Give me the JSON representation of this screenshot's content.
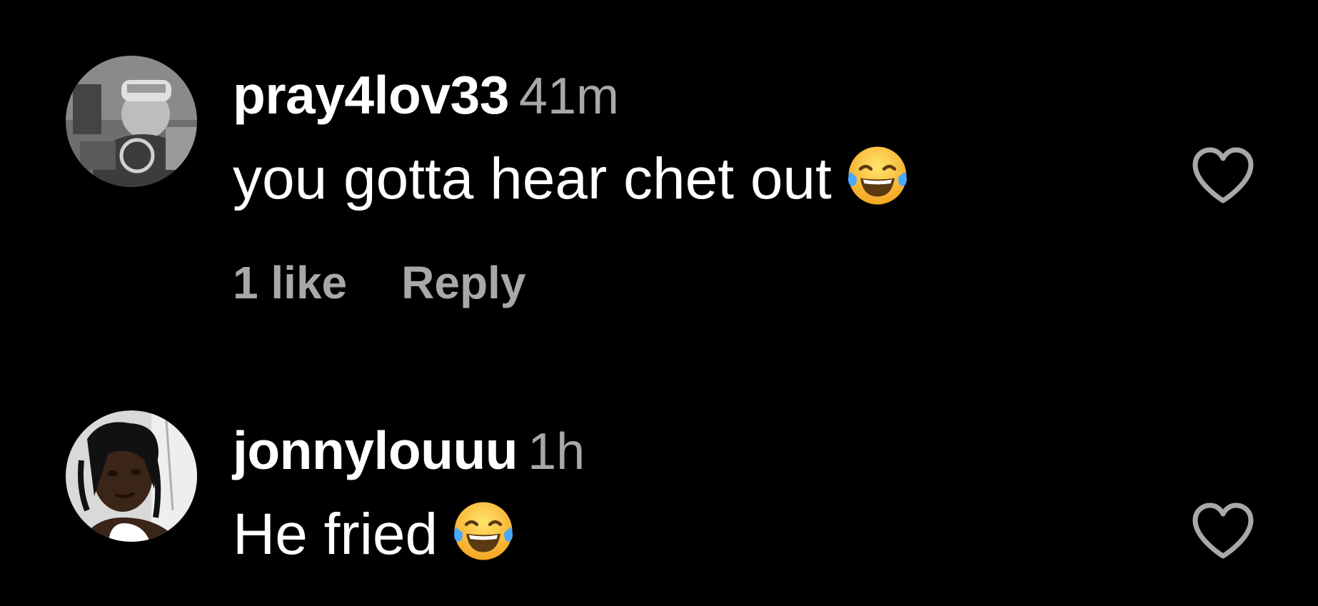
{
  "comments": [
    {
      "username": "pray4lov33",
      "time": "41m",
      "text": "you gotta hear chet out",
      "emoji": "face-with-tears-of-joy",
      "likes_label": "1 like",
      "reply_label": "Reply",
      "avatar_icon": "grayscale-user-photo"
    },
    {
      "username": "jonnylouuu",
      "time": "1h",
      "text": "He fried",
      "emoji": "face-with-tears-of-joy",
      "avatar_icon": "user-photo"
    }
  ],
  "icons": {
    "like": "heart-outline-icon"
  },
  "colors": {
    "background": "#000000",
    "primary_text": "#ffffff",
    "secondary_text": "#a8a8a8",
    "heart_outline": "#a8a8a8"
  }
}
